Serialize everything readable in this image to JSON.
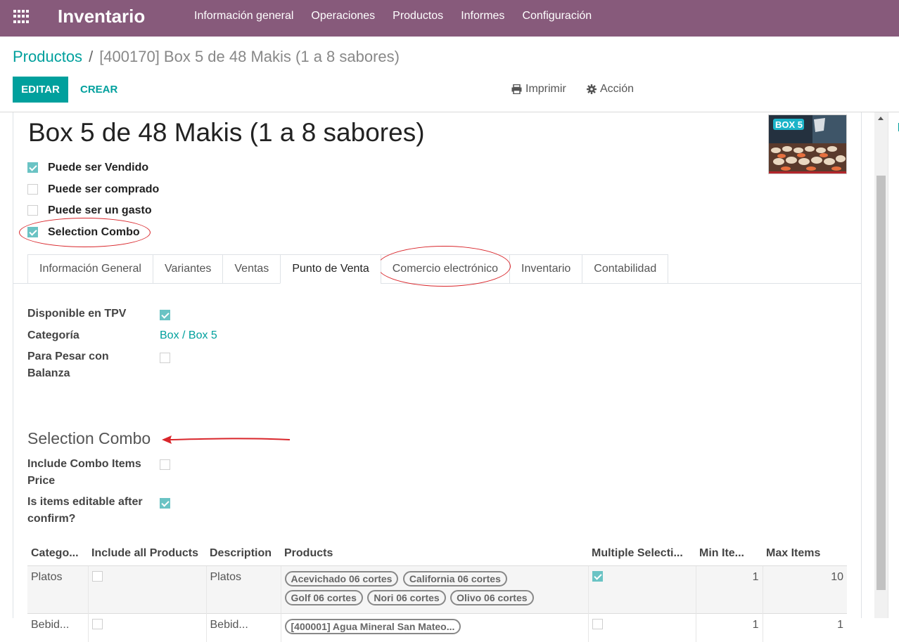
{
  "app": {
    "name": "Inventario",
    "menu": [
      "Información general",
      "Operaciones",
      "Productos",
      "Informes",
      "Configuración"
    ]
  },
  "breadcrumb": {
    "parent": "Productos",
    "separator": "/",
    "current": "[400170] Box 5 de 48 Makis (1 a 8 sabores)"
  },
  "toolbar": {
    "edit_label": "EDITAR",
    "create_label": "CREAR",
    "print_label": "Imprimir",
    "action_label": "Acción"
  },
  "product": {
    "title": "Box 5 de 48 Makis (1 a 8 sabores)",
    "image_label": "BOX 5",
    "options": [
      {
        "label": "Puede ser Vendido",
        "checked": true
      },
      {
        "label": "Puede ser comprado",
        "checked": false
      },
      {
        "label": "Puede ser un gasto",
        "checked": false
      },
      {
        "label": "Selection Combo",
        "checked": true
      }
    ]
  },
  "tabs": [
    {
      "label": "Información General",
      "active": false
    },
    {
      "label": "Variantes",
      "active": false
    },
    {
      "label": "Ventas",
      "active": false
    },
    {
      "label": "Punto de Venta",
      "active": true
    },
    {
      "label": "Comercio electrónico",
      "active": false
    },
    {
      "label": "Inventario",
      "active": false
    },
    {
      "label": "Contabilidad",
      "active": false
    }
  ],
  "pos": {
    "available_label": "Disponible en TPV",
    "available": true,
    "category_label": "Categoría",
    "category_value": "Box / Box 5",
    "weigh_label_1": "Para Pesar con",
    "weigh_label_2": "Balanza",
    "weigh": false
  },
  "combo": {
    "section_title": "Selection Combo",
    "include_price_label_1": "Include Combo Items",
    "include_price_label_2": "Price",
    "include_price": false,
    "editable_label_1": "Is items editable after",
    "editable_label_2": "confirm?",
    "editable": true
  },
  "table": {
    "headers": [
      "Catego...",
      "Include all Products",
      "Description",
      "Products",
      "Multiple Selecti...",
      "Min Ite...",
      "Max Items"
    ],
    "rows": [
      {
        "category": "Platos",
        "include_all": false,
        "description": "Platos",
        "products": [
          "Acevichado 06 cortes",
          "California 06 cortes",
          "Golf 06 cortes",
          "Nori 06 cortes",
          "Olivo 06 cortes"
        ],
        "multiple": true,
        "min": "1",
        "max": "10"
      },
      {
        "category": "Bebid...",
        "include_all": false,
        "description": "Bebid...",
        "products": [
          "[400001] Agua Mineral San Mateo..."
        ],
        "multiple": false,
        "min": "1",
        "max": "1"
      }
    ]
  },
  "colors": {
    "navbar": "#875a7b",
    "accent": "#00a09d",
    "annotation": "#d9262b"
  }
}
